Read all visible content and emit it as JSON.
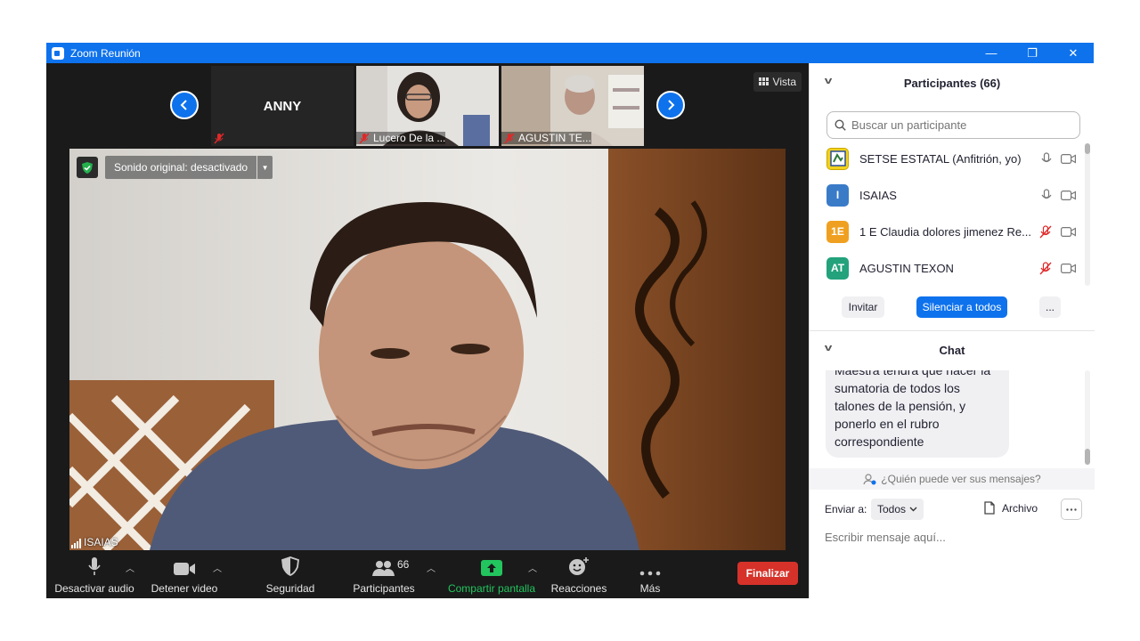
{
  "window": {
    "title": "Zoom Reunión",
    "minimize": "—",
    "restore": "❐",
    "close": "✕"
  },
  "strip": {
    "thumbs": [
      {
        "name": "ANNY"
      },
      {
        "name": "Lucero De la ..."
      },
      {
        "name": "AGUSTIN TE..."
      }
    ],
    "view_label": "Vista"
  },
  "main_video": {
    "original_sound": "Sonido original: desactivado",
    "speaker_name": "ISAIAS"
  },
  "toolbar": {
    "mute_audio": "Desactivar audio",
    "stop_video": "Detener video",
    "security": "Seguridad",
    "participants": "Participantes",
    "participants_count": "66",
    "share_screen": "Compartir pantalla",
    "reactions": "Reacciones",
    "more": "Más",
    "end": "Finalizar"
  },
  "participants_panel": {
    "title": "Participantes (66)",
    "search_placeholder": "Buscar un participante",
    "items": [
      {
        "name": "SETSE ESTATAL (Anfitrión, yo)",
        "avatar": "",
        "color": "#f2d21c",
        "muted": false
      },
      {
        "name": "ISAIAS",
        "avatar": "I",
        "color": "#3a7bc8",
        "muted": false
      },
      {
        "name": "1 E Claudia dolores jimenez Re...",
        "avatar": "1E",
        "color": "#f0a020",
        "muted": true
      },
      {
        "name": "AGUSTIN TEXON",
        "avatar": "AT",
        "color": "#23a27c",
        "muted": true
      }
    ],
    "invite": "Invitar",
    "mute_all": "Silenciar a todos",
    "more": "..."
  },
  "chat_panel": {
    "title": "Chat",
    "message": "Maestra tendrá que hacer la sumatoria de todos los talones de la pensión, y ponerlo en el rubro correspondiente",
    "who_can_see": "¿Quién puede ver sus mensajes?",
    "send_to_label": "Enviar a:",
    "send_to_value": "Todos",
    "file_label": "Archivo",
    "input_placeholder": "Escribir mensaje aquí..."
  },
  "colors": {
    "zoom_blue": "#0e72ed",
    "end_red": "#d6322a",
    "share_green": "#22c55e",
    "mute_red": "#e02828"
  }
}
